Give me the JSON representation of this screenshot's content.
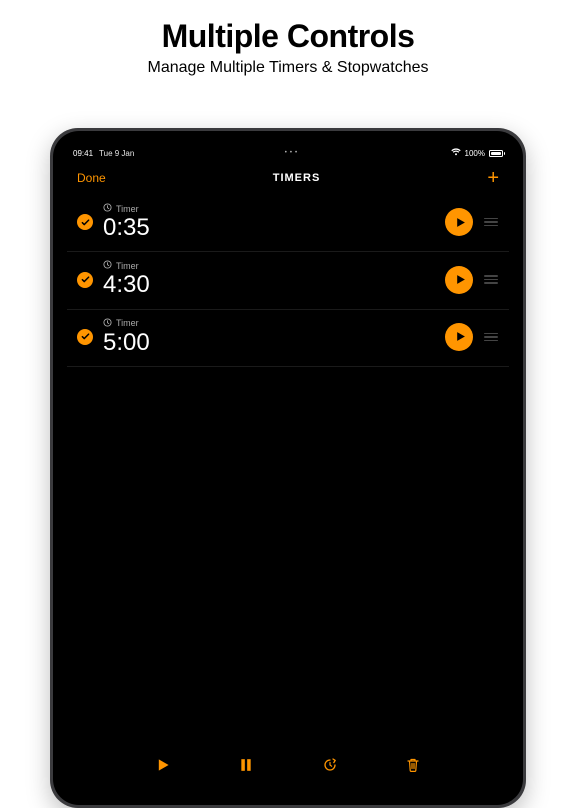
{
  "promo": {
    "title": "Multiple Controls",
    "subtitle": "Manage Multiple Timers & Stopwatches"
  },
  "status": {
    "time": "09:41",
    "date": "Tue 9 Jan",
    "battery_pct": "100%"
  },
  "nav": {
    "done": "Done",
    "title": "TIMERS",
    "add_glyph": "+"
  },
  "timers": [
    {
      "label": "Timer",
      "time": "0:35",
      "checked": true
    },
    {
      "label": "Timer",
      "time": "4:30",
      "checked": true
    },
    {
      "label": "Timer",
      "time": "5:00",
      "checked": true
    }
  ],
  "accent": "#ff9500"
}
